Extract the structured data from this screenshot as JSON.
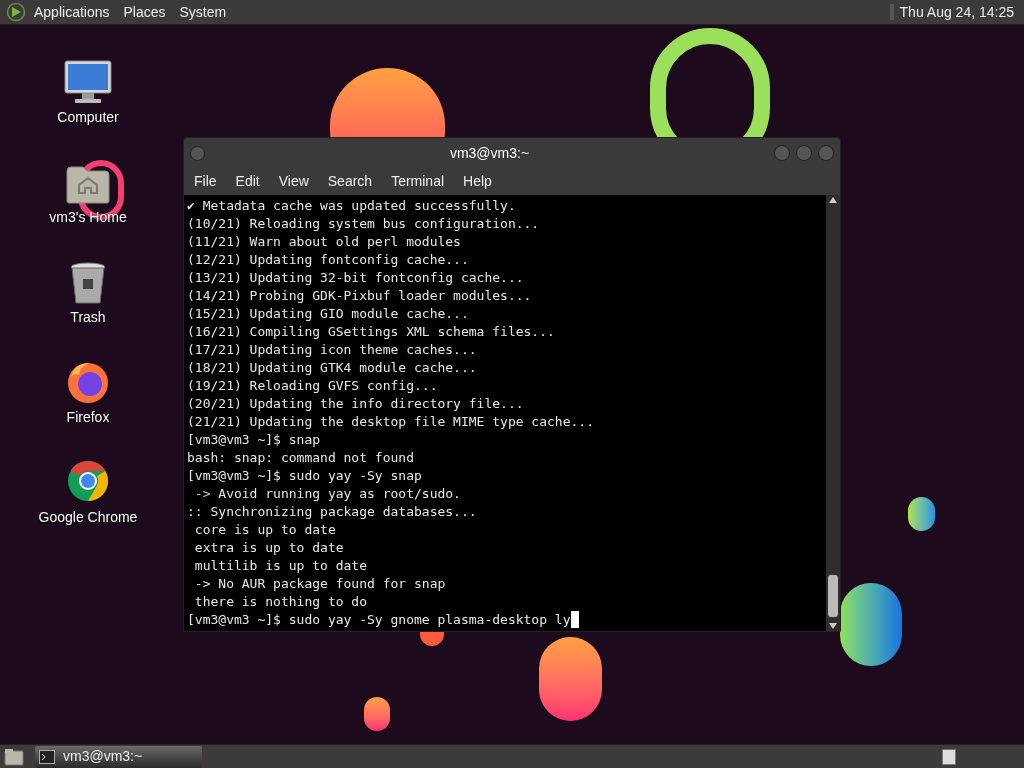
{
  "top_panel": {
    "menus": [
      "Applications",
      "Places",
      "System"
    ],
    "clock": "Thu Aug 24, 14:25"
  },
  "desktop_icons": [
    {
      "label": "Computer",
      "kind": "computer"
    },
    {
      "label": "vm3's Home",
      "kind": "home"
    },
    {
      "label": "Trash",
      "kind": "trash"
    },
    {
      "label": "Firefox",
      "kind": "firefox"
    },
    {
      "label": "Google Chrome",
      "kind": "chrome"
    }
  ],
  "window": {
    "title": "vm3@vm3:~",
    "menu": [
      "File",
      "Edit",
      "View",
      "Search",
      "Terminal",
      "Help"
    ],
    "lines": [
      {
        "kind": "plain",
        "text": "✔ Metadata cache was updated successfully."
      },
      {
        "kind": "plain",
        "text": "(10/21) Reloading system bus configuration..."
      },
      {
        "kind": "plain",
        "text": "(11/21) Warn about old perl modules"
      },
      {
        "kind": "plain",
        "text": "(12/21) Updating fontconfig cache..."
      },
      {
        "kind": "plain",
        "text": "(13/21) Updating 32-bit fontconfig cache..."
      },
      {
        "kind": "plain",
        "text": "(14/21) Probing GDK-Pixbuf loader modules..."
      },
      {
        "kind": "plain",
        "text": "(15/21) Updating GIO module cache..."
      },
      {
        "kind": "plain",
        "text": "(16/21) Compiling GSettings XML schema files..."
      },
      {
        "kind": "plain",
        "text": "(17/21) Updating icon theme caches..."
      },
      {
        "kind": "plain",
        "text": "(18/21) Updating GTK4 module cache..."
      },
      {
        "kind": "plain",
        "text": "(19/21) Reloading GVFS config..."
      },
      {
        "kind": "plain",
        "text": "(20/21) Updating the info directory file..."
      },
      {
        "kind": "plain",
        "text": "(21/21) Updating the desktop file MIME type cache..."
      },
      {
        "kind": "plain",
        "text": "[vm3@vm3 ~]$ snap"
      },
      {
        "kind": "plain",
        "text": "bash: snap: command not found"
      },
      {
        "kind": "plain",
        "text": "[vm3@vm3 ~]$ sudo yay -Sy snap"
      },
      {
        "kind": "warning",
        "marker": " ->",
        "text": " Avoid running yay as root/sudo."
      },
      {
        "kind": "plain",
        "text": ":: Synchronizing package databases..."
      },
      {
        "kind": "plain",
        "text": " core is up to date"
      },
      {
        "kind": "plain",
        "text": " extra is up to date"
      },
      {
        "kind": "plain",
        "text": " multilib is up to date"
      },
      {
        "kind": "plain",
        "text": " -> No AUR package found for snap"
      },
      {
        "kind": "plain",
        "text": " there is nothing to do"
      },
      {
        "kind": "prompt",
        "text": "[vm3@vm3 ~]$ sudo yay -Sy gnome plasma-desktop ly"
      }
    ]
  },
  "taskbar": {
    "tasks": [
      {
        "label": "vm3@vm3:~",
        "selected": true
      }
    ]
  }
}
